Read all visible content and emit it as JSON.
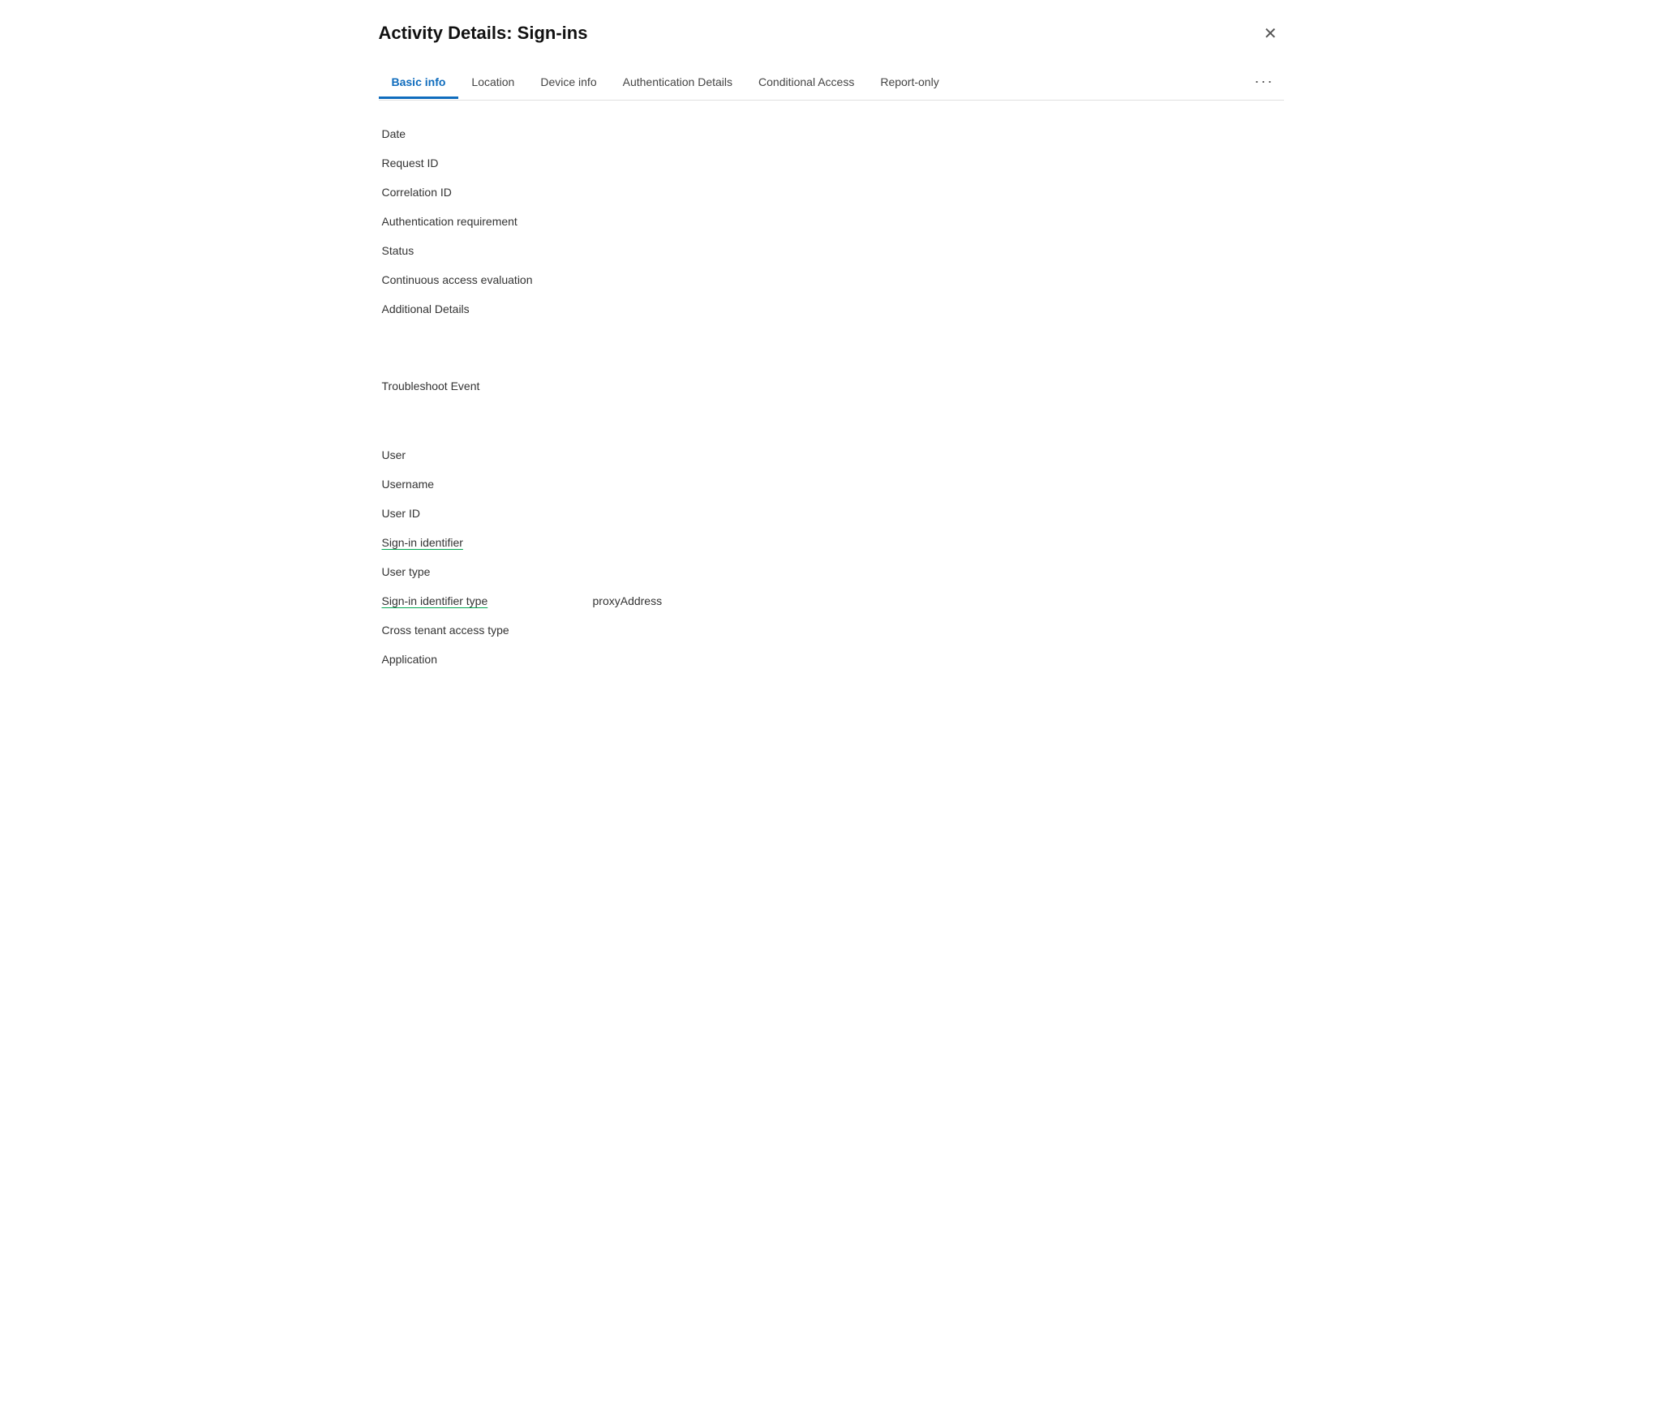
{
  "dialog": {
    "title": "Activity Details: Sign-ins",
    "close_label": "✕"
  },
  "tabs": [
    {
      "id": "basic-info",
      "label": "Basic info",
      "active": true
    },
    {
      "id": "location",
      "label": "Location",
      "active": false
    },
    {
      "id": "device-info",
      "label": "Device info",
      "active": false
    },
    {
      "id": "authentication-details",
      "label": "Authentication Details",
      "active": false
    },
    {
      "id": "conditional-access",
      "label": "Conditional Access",
      "active": false
    },
    {
      "id": "report-only",
      "label": "Report-only",
      "active": false
    }
  ],
  "tab_more": "···",
  "fields_section1": [
    {
      "label": "Date",
      "value": "",
      "underlined": false
    },
    {
      "label": "Request ID",
      "value": "",
      "underlined": false
    },
    {
      "label": "Correlation ID",
      "value": "",
      "underlined": false
    },
    {
      "label": "Authentication requirement",
      "value": "",
      "underlined": false
    },
    {
      "label": "Status",
      "value": "",
      "underlined": false
    },
    {
      "label": "Continuous access evaluation",
      "value": "",
      "underlined": false
    },
    {
      "label": "Additional Details",
      "value": "",
      "underlined": false
    }
  ],
  "troubleshoot_label": "Troubleshoot Event",
  "fields_section2": [
    {
      "label": "User",
      "value": "",
      "underlined": false
    },
    {
      "label": "Username",
      "value": "",
      "underlined": false
    },
    {
      "label": "User ID",
      "value": "",
      "underlined": false
    },
    {
      "label": "Sign-in identifier",
      "value": "",
      "underlined": true
    },
    {
      "label": "User type",
      "value": "",
      "underlined": false
    },
    {
      "label": "Sign-in identifier type",
      "value": "proxyAddress",
      "underlined": true
    },
    {
      "label": "Cross tenant access type",
      "value": "",
      "underlined": false
    },
    {
      "label": "Application",
      "value": "",
      "underlined": false
    }
  ]
}
